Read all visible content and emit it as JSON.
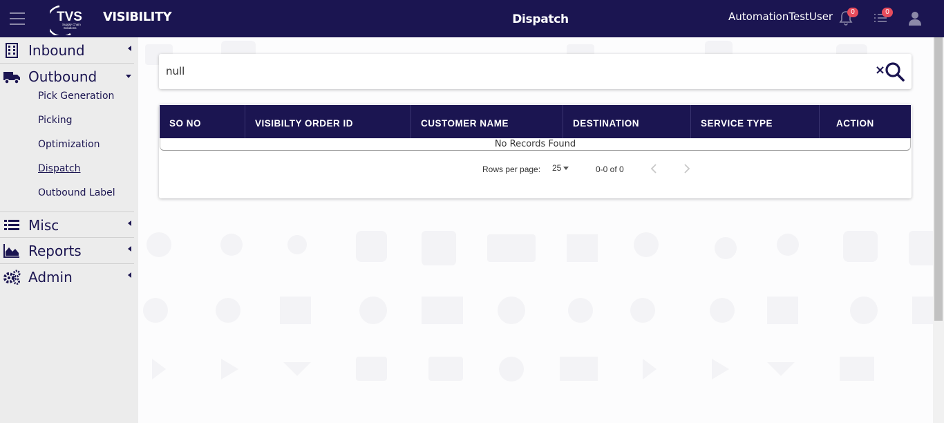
{
  "header": {
    "app_name": "VISIBILITY",
    "logo_text": "TVS",
    "logo_subtext": "Supply Chain Solutions",
    "page_title": "Dispatch",
    "username": "AutomationTestUser",
    "notification_count": "0",
    "tasks_count": "0"
  },
  "sidebar": {
    "inbound": "Inbound",
    "outbound": "Outbound",
    "outbound_items": [
      "Pick Generation",
      "Picking",
      "Optimization",
      "Dispatch",
      "Outbound Label"
    ],
    "misc": "Misc",
    "reports": "Reports",
    "admin": "Admin"
  },
  "search": {
    "value": "null"
  },
  "table": {
    "columns": [
      "SO NO",
      "VISIBILTY ORDER ID",
      "CUSTOMER NAME",
      "DESTINATION",
      "SERVICE TYPE",
      "ACTION"
    ],
    "empty_message": "No Records Found",
    "rows_per_page_label": "Rows per page:",
    "rows_per_page_value": "25",
    "range_label": "0-0 of 0"
  },
  "colors": {
    "brand": "#1b1551",
    "badge": "#e74c5c"
  }
}
